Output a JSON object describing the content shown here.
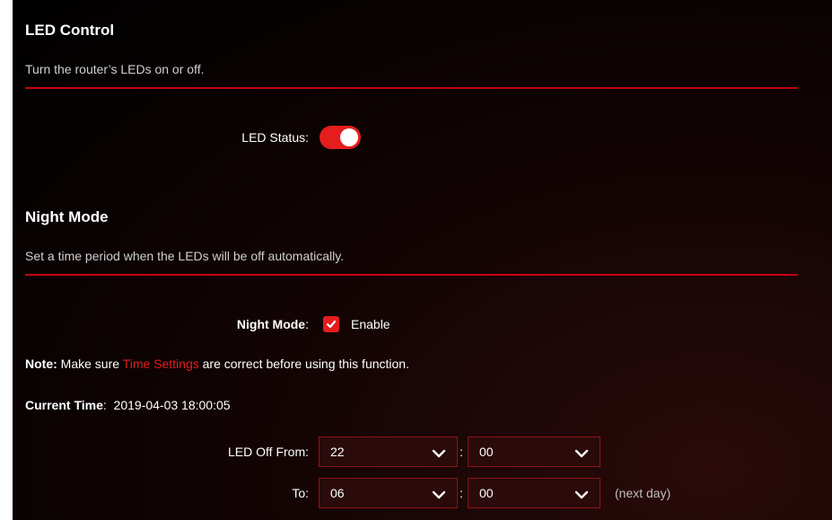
{
  "led_control": {
    "title": "LED Control",
    "description": "Turn the router’s LEDs on or off.",
    "status_label": "LED Status:",
    "status_on": true
  },
  "night_mode": {
    "title": "Night Mode",
    "description": "Set a time period when the LEDs will be off automatically.",
    "field_label": "Night Mode",
    "field_colon": ":",
    "enable_label": "Enable",
    "enabled": true,
    "note_prefix": "Note:",
    "note_text_1": "Make sure",
    "note_link": "Time Settings",
    "note_text_2": "are correct before using this function.",
    "current_time_label": "Current Time",
    "current_time_colon": ":",
    "current_time_value": "2019-04-03 18:00:05",
    "from_label": "LED Off From:",
    "from_hour": "22",
    "from_minute": "00",
    "to_label": "To:",
    "to_hour": "06",
    "to_minute": "00",
    "time_separator": ":",
    "next_day": "(next day)"
  },
  "colors": {
    "accent": "#e41d1d",
    "rule": "#c6000f",
    "select_border": "#8b1414"
  },
  "icons": {
    "dropdown": "chevron-down-icon",
    "check": "check-icon"
  }
}
